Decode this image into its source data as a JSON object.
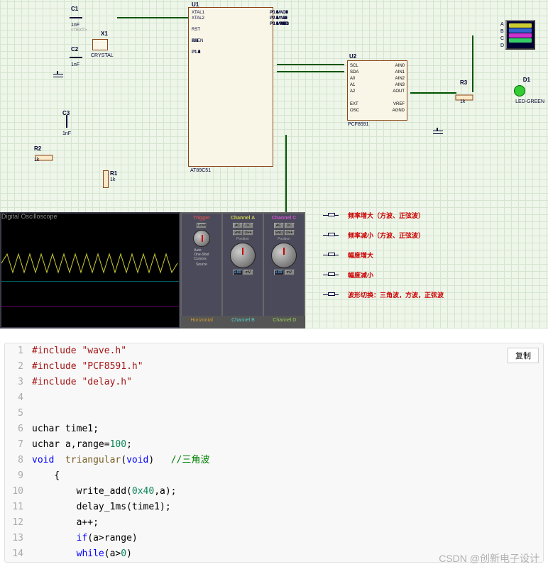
{
  "schematic": {
    "u1": {
      "ref": "U1",
      "part": "AT89C51",
      "pins_left": [
        "XTAL1",
        "XTAL2",
        "RST",
        "PSEN",
        "ALE",
        "EA",
        "P1.0",
        "P1.1",
        "P1.2",
        "P1.3",
        "P1.4",
        "P1.5",
        "P1.6",
        "P1.7"
      ],
      "pins_right": [
        "P0.0/AD0",
        "P0.1/AD1",
        "P0.2/AD2",
        "P0.3/AD3",
        "P0.4/AD4",
        "P0.5/AD5",
        "P0.6/AD6",
        "P0.7/AD7",
        "P2.0/A8",
        "P2.1/A9",
        "P2.2/A10",
        "P2.3/A11",
        "P2.4/A12",
        "P2.5/A13",
        "P2.6/A14",
        "P2.7/A15",
        "P3.0/RXD",
        "P3.1/TXD",
        "P3.2/INT0",
        "P3.3/INT1",
        "P3.4/T0",
        "P3.5/T1",
        "P3.6/WR",
        "P3.7/RD"
      ]
    },
    "u2": {
      "ref": "U2",
      "part": "PCF8591",
      "pins_left": [
        "SCL",
        "SDA",
        "A0",
        "A1",
        "A2",
        "EXT",
        "OSC"
      ],
      "pins_right": [
        "AIN0",
        "AIN1",
        "AIN2",
        "AIN3",
        "AOUT",
        "VREF",
        "AGND"
      ]
    },
    "components": {
      "C1": {
        "ref": "C1",
        "value": "1nF"
      },
      "C2": {
        "ref": "C2",
        "value": "1nF"
      },
      "C3": {
        "ref": "C3",
        "value": "1nF"
      },
      "X1": {
        "ref": "X1",
        "value": "CRYSTAL"
      },
      "R1": {
        "ref": "R1",
        "value": "1k"
      },
      "R2": {
        "ref": "R2",
        "value": "1k"
      },
      "R3": {
        "ref": "R3",
        "value": "1k"
      },
      "D1": {
        "ref": "D1",
        "value": "LED-GREEN"
      }
    },
    "buttons": [
      {
        "label": "频率增大（方波、正弦波）"
      },
      {
        "label": "频率减小（方波、正弦波）"
      },
      {
        "label": "幅度增大"
      },
      {
        "label": "幅度减小"
      },
      {
        "label": "波形切换：三角波，方波，正弦波"
      }
    ],
    "scope_channels": [
      "A",
      "B",
      "C",
      "D"
    ]
  },
  "oscilloscope": {
    "title": "Digital Oscilloscope",
    "columns": [
      {
        "title": "Trigger",
        "color": "#c33"
      },
      {
        "title": "Channel A",
        "color": "#cc3"
      },
      {
        "title": "Channel B",
        "color": "#3cc"
      },
      {
        "title": "Channel C",
        "color": "#c3c"
      }
    ],
    "row2": [
      "Horizontal",
      "Channel B",
      "Channel C",
      "Channel D"
    ],
    "buttons": [
      "AC",
      "DC",
      "GND",
      "OFF",
      "Auto",
      "One-Shot",
      "Cursors",
      "Source"
    ],
    "readouts": [
      "1.00",
      "mV",
      "Position"
    ]
  },
  "code": {
    "copy_label": "复制",
    "lines": [
      {
        "n": 1,
        "html": "<span class='kw2'>#include</span> <span class='str'>\"wave.h\"</span>"
      },
      {
        "n": 2,
        "html": "<span class='kw2'>#include</span> <span class='str'>\"PCF8591.h\"</span>"
      },
      {
        "n": 3,
        "html": "<span class='kw2'>#include</span> <span class='str'>\"delay.h\"</span>"
      },
      {
        "n": 4,
        "html": ""
      },
      {
        "n": 5,
        "html": ""
      },
      {
        "n": 6,
        "html": "uchar time1;"
      },
      {
        "n": 7,
        "html": "uchar a,range=<span class='num'>100</span>;"
      },
      {
        "n": 8,
        "html": "<span class='kw'>void</span>  <span class='fn'>triangular</span>(<span class='kw'>void</span>)   <span class='cm'>//三角波</span>"
      },
      {
        "n": 9,
        "html": "    {"
      },
      {
        "n": 10,
        "html": "        write_add(<span class='num'>0x40</span>,a);"
      },
      {
        "n": 11,
        "html": "        delay_1ms(time1);"
      },
      {
        "n": 12,
        "html": "        a++;"
      },
      {
        "n": 13,
        "html": "        <span class='kw'>if</span>(a&gt;range)"
      },
      {
        "n": 14,
        "html": "        <span class='kw'>while</span>(a&gt;<span class='num'>0</span>)"
      }
    ]
  },
  "watermark": "CSDN @创新电子设计"
}
